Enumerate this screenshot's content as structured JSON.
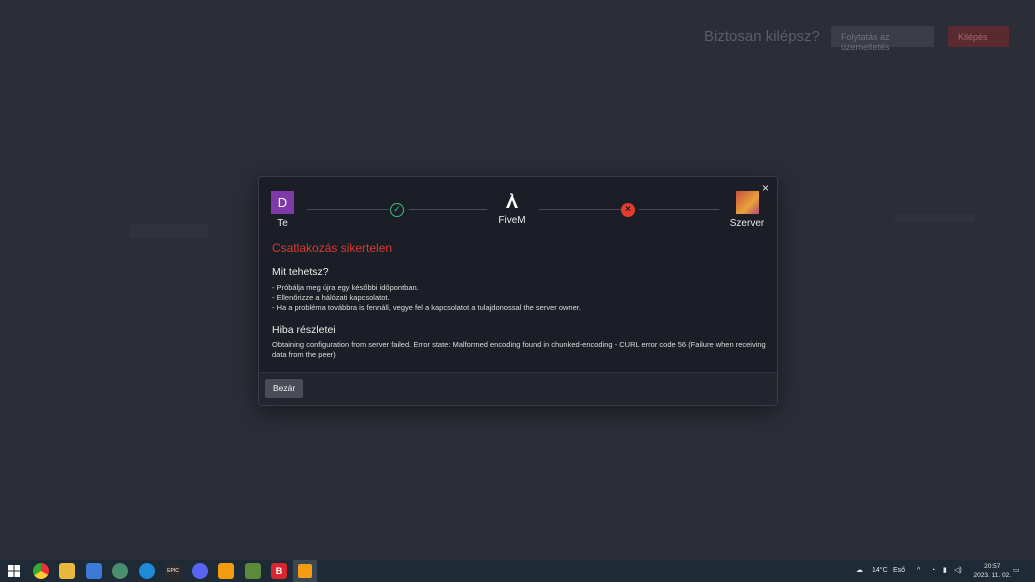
{
  "background": {
    "confirm_title": "Biztosan kilépsz?",
    "confirm_back": "Folytatás az üzemeltetés",
    "confirm_quit": "Kilépés"
  },
  "modal": {
    "nodes": {
      "you": {
        "letter": "D",
        "label": "Te"
      },
      "platform": {
        "label": "FiveM"
      },
      "server": {
        "label": "Szerver"
      }
    },
    "fail_title": "Csatlakozás sikertelen",
    "what_title": "Mit tehetsz?",
    "tips": [
      "- Próbálja meg újra egy későbbi időpontban.",
      "- Ellenőrizze a hálózati kapcsolatot.",
      "- Ha a probléma továbbra is fennáll, vegye fel a kapcsolatot a tulajdonossal the server owner."
    ],
    "details_title": "Hiba részletei",
    "details_text": "Obtaining configuration from server failed. Error state: Malformed encoding found in chunked-encoding - CURL error code 56 (Failure when receiving data from the peer)",
    "close_label": "Bezár",
    "close_icon": "×",
    "ok_icon": "✓",
    "err_icon": "×"
  },
  "taskbar": {
    "weather": "14°C",
    "weather_desc": "Eső",
    "time": "20:57",
    "date": "2023. 11. 02.",
    "apps": [
      "start",
      "chrome",
      "explorer",
      "store",
      "app",
      "edge",
      "epic",
      "discord",
      "fivem",
      "minecraft",
      "bitdefender",
      "fivem-active"
    ]
  },
  "colors": {
    "error": "#d63b2f",
    "success": "#3dbd7d",
    "modal_bg": "#1c1e27"
  }
}
